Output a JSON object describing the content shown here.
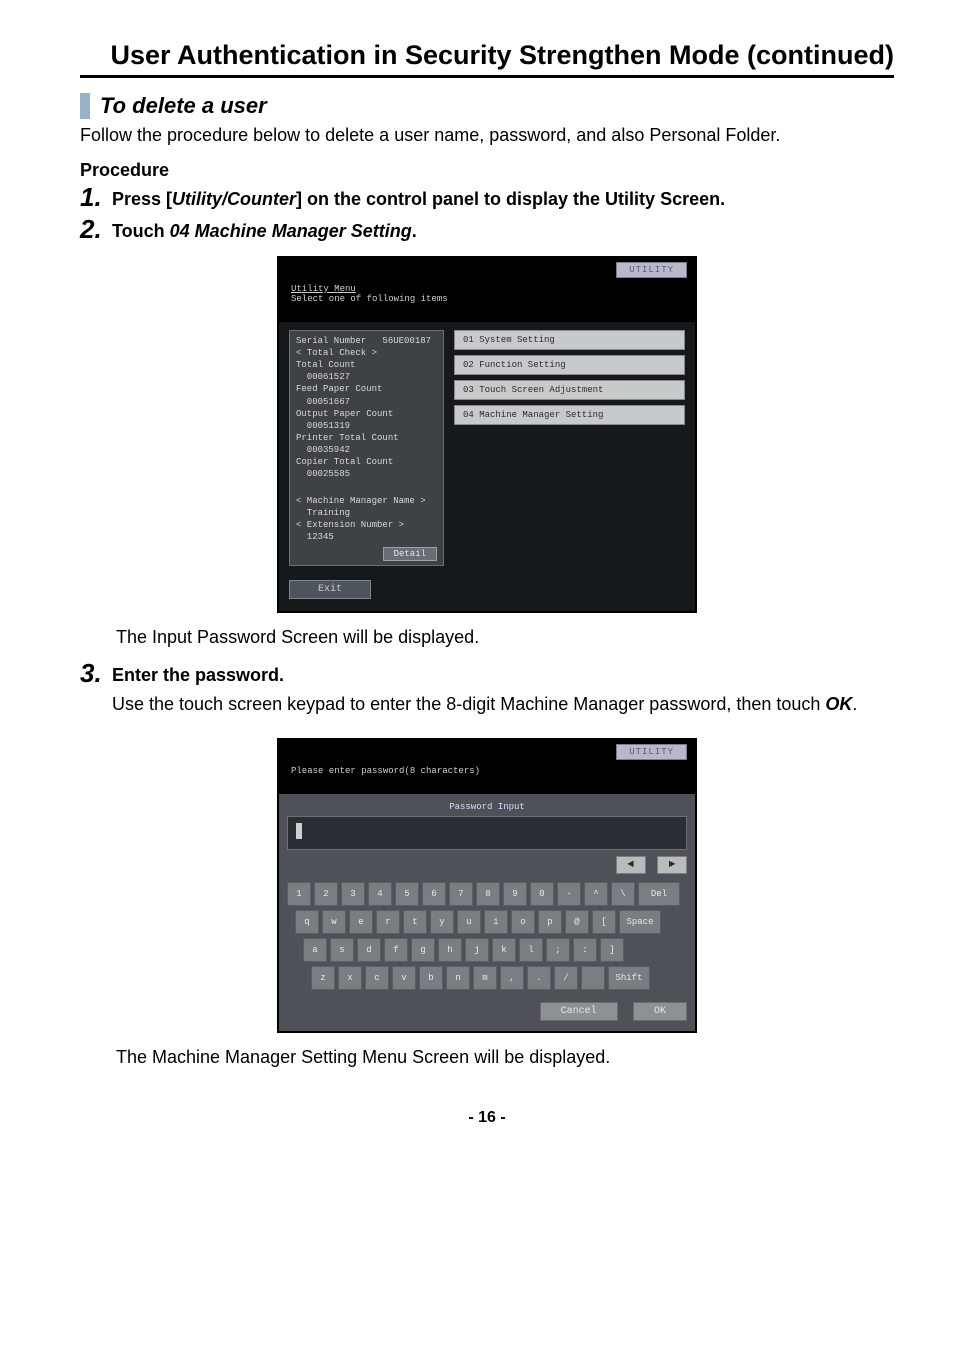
{
  "title": "User Authentication in Security Strengthen Mode (continued)",
  "section_heading": "To delete a user",
  "intro": "Follow the procedure below to delete a user name, password, and also Personal Folder.",
  "procedure_label": "Procedure",
  "steps": {
    "s1": {
      "num": "1.",
      "lead": "Press [",
      "emph": "Utility/Counter",
      "tail": "] on the control panel to display the Utility Screen."
    },
    "s2": {
      "num": "2.",
      "lead": "Touch ",
      "emph": "04 Machine Manager Setting",
      "tail": "."
    },
    "s2_after": "The Input Password Screen will be displayed.",
    "s3": {
      "num": "3.",
      "lead": "Enter the password.",
      "desc_a": "Use the touch screen keypad to enter the 8-digit Machine Manager password, then touch ",
      "desc_ok": "OK",
      "desc_b": "."
    },
    "s3_after": "The Machine Manager Setting Menu Screen will be displayed."
  },
  "page_number": "- 16 -",
  "screenshot1": {
    "badge": "UTILITY",
    "header_line1": "Utility Menu",
    "header_line2": "Select one of following items",
    "left": {
      "serial_row": "Serial Number   56UE00187",
      "total_check": "< Total Check >",
      "total_count_lbl": "Total Count",
      "total_count_val": "  00061527",
      "feed_lbl": "Feed Paper Count",
      "feed_val": "  00051667",
      "out_lbl": "Output Paper Count",
      "out_val": "  00051319",
      "prn_lbl": "Printer Total Count",
      "prn_val": "  00035942",
      "cop_lbl": "Copier Total Count",
      "cop_val": "  00025585",
      "mgr_name_lbl": "< Machine Manager Name >",
      "mgr_name_val": "  Training",
      "ext_lbl": "< Extension Number >",
      "ext_val": "  12345",
      "detail_btn": "Detail"
    },
    "right": {
      "b1": "01 System Setting",
      "b2": "02 Function Setting",
      "b3": "03 Touch Screen Adjustment",
      "b4": "04 Machine Manager Setting"
    },
    "exit": "Exit"
  },
  "screenshot2": {
    "badge": "UTILITY",
    "header": "Please enter password(8 characters)",
    "label": "Password Input",
    "nav_left": "◄",
    "nav_right": "►",
    "row1": [
      "1",
      "2",
      "3",
      "4",
      "5",
      "6",
      "7",
      "8",
      "9",
      "0",
      "-",
      "^",
      "\\",
      "Del"
    ],
    "row2": [
      "q",
      "w",
      "e",
      "r",
      "t",
      "y",
      "u",
      "i",
      "o",
      "p",
      "@",
      "[",
      "Space"
    ],
    "row3": [
      "a",
      "s",
      "d",
      "f",
      "g",
      "h",
      "j",
      "k",
      "l",
      ";",
      ":",
      "]"
    ],
    "row4": [
      "z",
      "x",
      "c",
      "v",
      "b",
      "n",
      "m",
      ",",
      ".",
      "/",
      "",
      "Shift"
    ],
    "cancel": "Cancel",
    "ok": "OK"
  }
}
